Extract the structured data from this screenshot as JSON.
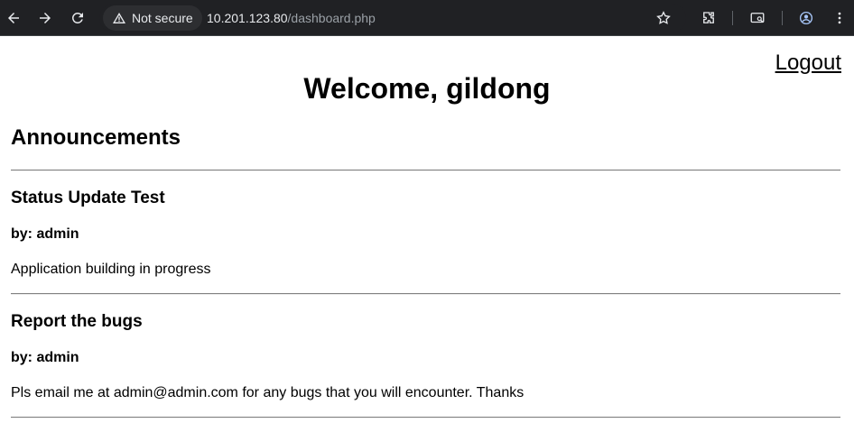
{
  "browser": {
    "security_label": "Not secure",
    "url_host": "10.201.123.80",
    "url_path": "/dashboard.php"
  },
  "page": {
    "logout_label": "Logout",
    "welcome": "Welcome, gildong",
    "section_title": "Announcements"
  },
  "announcements": [
    {
      "title": "Status Update Test",
      "author": "by: admin",
      "body": "Application building in progress"
    },
    {
      "title": "Report the bugs",
      "author": "by: admin",
      "body": "Pls email me at admin@admin.com for any bugs that you will encounter. Thanks"
    }
  ]
}
